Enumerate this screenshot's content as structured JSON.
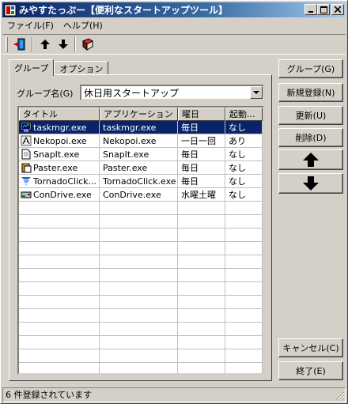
{
  "window": {
    "title": "みやすたっぷー【便利なスタートアップツール】",
    "buttons": {
      "minimize": "_",
      "maximize": "□",
      "close": "×"
    }
  },
  "menu": [
    {
      "label": "ファイル(F)"
    },
    {
      "label": "ヘルプ(H)"
    }
  ],
  "toolbar": {
    "icons": [
      "exit-icon",
      "up-arrow-icon",
      "down-arrow-icon",
      "book-icon"
    ]
  },
  "tabs": [
    {
      "label": "グループ",
      "active": true
    },
    {
      "label": "オプション",
      "active": false
    }
  ],
  "group": {
    "label": "グループ名(G)",
    "selected": "休日用スタートアップ"
  },
  "table": {
    "columns": [
      "タイトル",
      "アプリケーション",
      "曜日",
      "起動..."
    ],
    "rows": [
      {
        "title": "taskmgr.exe",
        "app": "taskmgr.exe",
        "day": "毎日",
        "launch": "なし",
        "icon": "task-manager-icon",
        "selected": true
      },
      {
        "title": "Nekopoi.exe",
        "app": "Nekopoi.exe",
        "day": "一日一回",
        "launch": "あり",
        "icon": "cat-icon",
        "selected": false
      },
      {
        "title": "SnapIt.exe",
        "app": "SnapIt.exe",
        "day": "毎日",
        "launch": "なし",
        "icon": "document-icon",
        "selected": false
      },
      {
        "title": "Paster.exe",
        "app": "Paster.exe",
        "day": "毎日",
        "launch": "なし",
        "icon": "paste-icon",
        "selected": false
      },
      {
        "title": "TornadoClick...",
        "app": "TornadoClick.exe",
        "day": "毎日",
        "launch": "なし",
        "icon": "tornado-icon",
        "selected": false
      },
      {
        "title": "ConDrive.exe",
        "app": "ConDrive.exe",
        "day": "水曜土曜",
        "launch": "なし",
        "icon": "drive-icon",
        "selected": false
      }
    ]
  },
  "buttons": {
    "group": "グループ(G)",
    "new": "新規登録(N)",
    "update": "更新(U)",
    "delete": "削除(D)",
    "cancel": "キャンセル(C)",
    "exit": "終了(E)"
  },
  "status": "6 件登録されています"
}
